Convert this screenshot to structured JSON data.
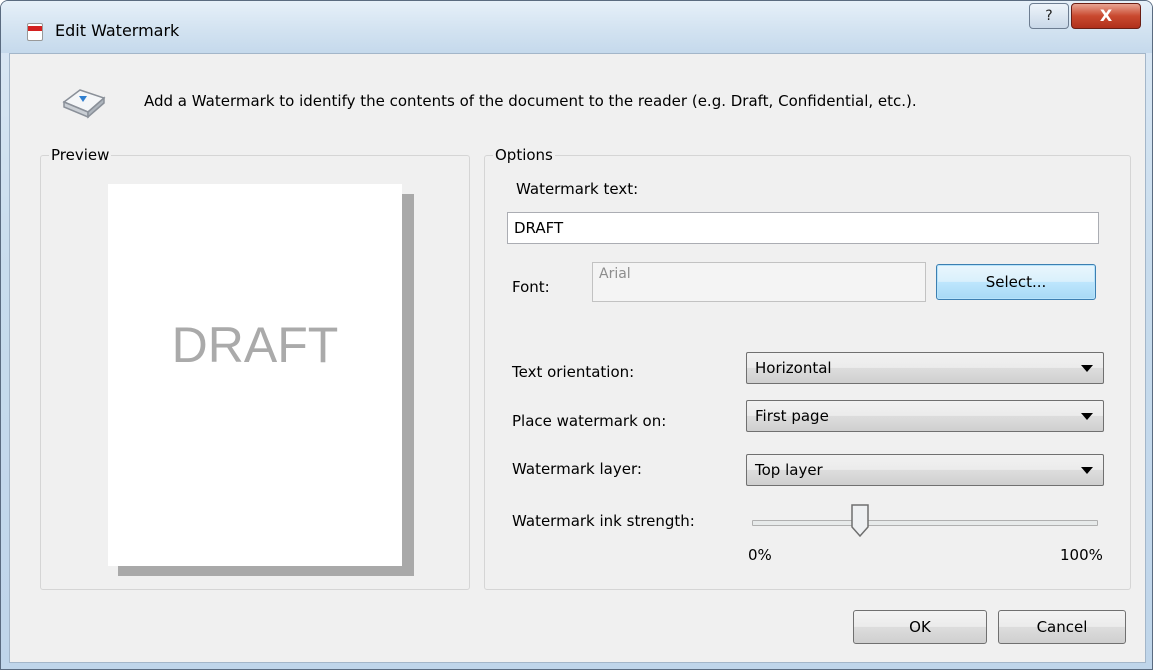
{
  "window": {
    "title": "Edit Watermark",
    "help_glyph": "?",
    "close_glyph": "X",
    "app_icon": "document-icon"
  },
  "info": {
    "icon": "watermark-stamp-icon",
    "text": "Add a Watermark to identify the contents of the document to the reader (e.g. Draft, Confidential, etc.)."
  },
  "preview": {
    "legend": "Preview",
    "page_text": "DRAFT"
  },
  "options": {
    "legend": "Options",
    "watermark_text_label": "Watermark text:",
    "watermark_text_value": "DRAFT",
    "font_label": "Font:",
    "font_value": "Arial",
    "select_button": "Select...",
    "orientation_label": "Text orientation:",
    "orientation_value": "Horizontal",
    "place_label": "Place watermark on:",
    "place_value": "First page",
    "layer_label": "Watermark layer:",
    "layer_value": "Top layer",
    "strength_label": "Watermark ink strength:",
    "strength_min": "0%",
    "strength_max": "100%",
    "strength_level": 0.31
  },
  "footer": {
    "ok": "OK",
    "cancel": "Cancel"
  },
  "colors": {
    "titlebar": "#d3e3f1",
    "dialog_bg": "#f0f0f0",
    "close_button": "#c9492f",
    "preview_text": "#aaaaaa"
  }
}
